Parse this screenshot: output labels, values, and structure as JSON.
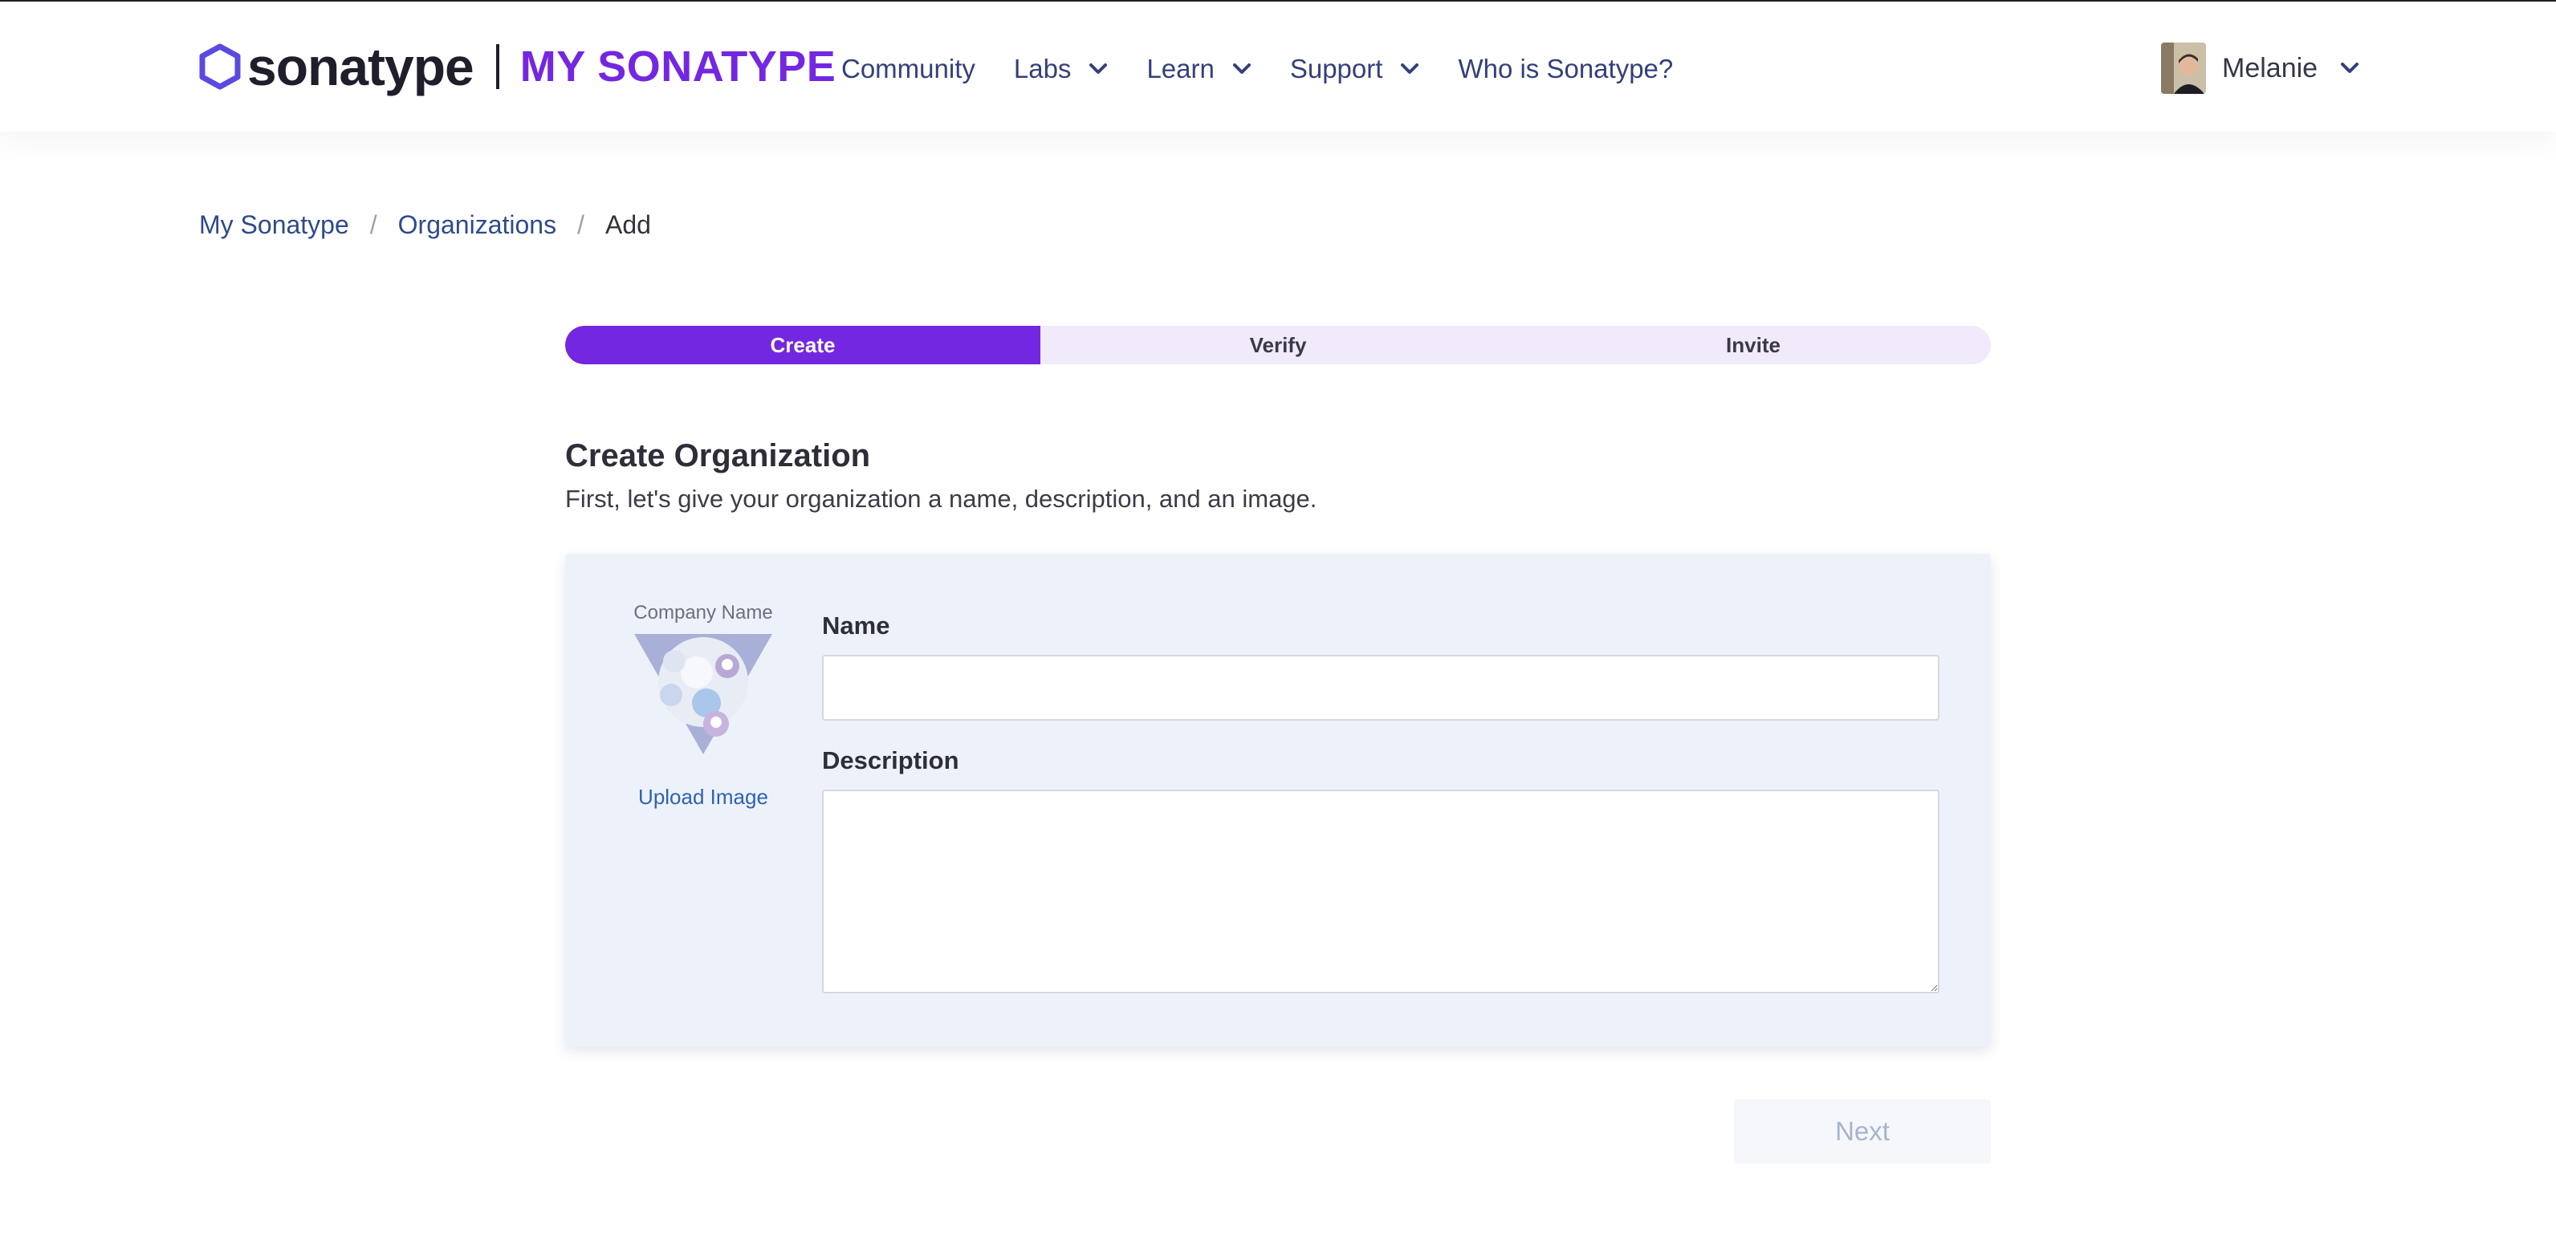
{
  "brand": {
    "wordmark": "sonatype",
    "product": "MY SONATYPE",
    "accent_color": "#7427e0"
  },
  "nav": {
    "items": [
      {
        "label": "Community",
        "dropdown": false
      },
      {
        "label": "Labs",
        "dropdown": true
      },
      {
        "label": "Learn",
        "dropdown": true
      },
      {
        "label": "Support",
        "dropdown": true
      },
      {
        "label": "Who is Sonatype?",
        "dropdown": false
      }
    ]
  },
  "user": {
    "name": "Melanie",
    "avatar_icon": "user-avatar"
  },
  "breadcrumb": {
    "items": [
      "My Sonatype",
      "Organizations",
      "Add"
    ],
    "separator": "/"
  },
  "stepper": {
    "steps": [
      "Create",
      "Verify",
      "Invite"
    ],
    "active": "Create"
  },
  "page": {
    "title": "Create Organization",
    "subtitle": "First, let's give your organization a name, description, and an image."
  },
  "form": {
    "logo_caption": "Company Name",
    "upload_label": "Upload Image",
    "name_label": "Name",
    "name_value": "",
    "description_label": "Description",
    "description_value": ""
  },
  "actions": {
    "next_label": "Next",
    "next_enabled": false
  }
}
